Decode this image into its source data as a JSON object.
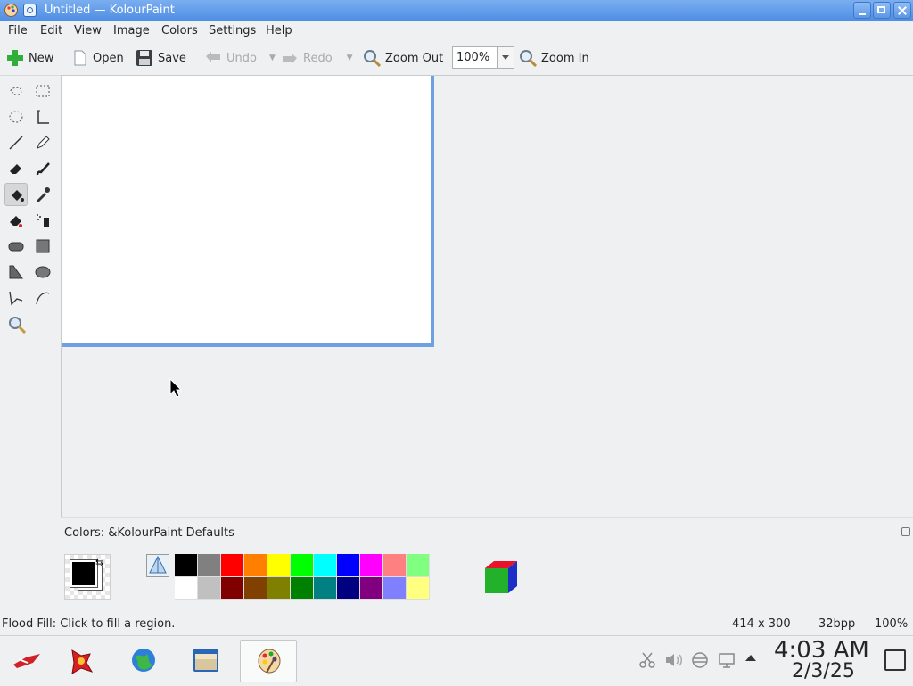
{
  "window": {
    "title": "Untitled — KolourPaint",
    "buttons": {
      "minimize": "minimize",
      "maximize": "maximize",
      "close": "close"
    }
  },
  "menubar": {
    "items": [
      "File",
      "Edit",
      "View",
      "Image",
      "Colors",
      "Settings",
      "Help"
    ]
  },
  "toolbar": {
    "new_label": "New",
    "open_label": "Open",
    "save_label": "Save",
    "undo_label": "Undo",
    "redo_label": "Redo",
    "zoom_out_label": "Zoom Out",
    "zoom_value": "100%",
    "zoom_in_label": "Zoom In"
  },
  "tools": [
    {
      "name": "free-form-selection",
      "icon": "lasso-icon"
    },
    {
      "name": "rectangular-selection",
      "icon": "rect-select-icon"
    },
    {
      "name": "elliptical-selection",
      "icon": "ellipse-select-icon"
    },
    {
      "name": "text",
      "icon": "text-icon"
    },
    {
      "name": "line",
      "icon": "line-icon"
    },
    {
      "name": "pen",
      "icon": "pen-icon"
    },
    {
      "name": "eraser",
      "icon": "eraser-icon"
    },
    {
      "name": "brush",
      "icon": "brush-icon"
    },
    {
      "name": "flood-fill",
      "icon": "flood-fill-icon",
      "active": true
    },
    {
      "name": "color-picker",
      "icon": "color-picker-icon"
    },
    {
      "name": "color-eraser",
      "icon": "color-eraser-icon"
    },
    {
      "name": "spraycan",
      "icon": "spraycan-icon"
    },
    {
      "name": "rounded-rectangle",
      "icon": "rounded-rect-icon"
    },
    {
      "name": "rectangle",
      "icon": "rectangle-icon"
    },
    {
      "name": "polygon",
      "icon": "polygon-icon"
    },
    {
      "name": "ellipse",
      "icon": "ellipse-icon"
    },
    {
      "name": "connected-lines",
      "icon": "polyline-icon"
    },
    {
      "name": "curve",
      "icon": "curve-icon"
    },
    {
      "name": "zoom",
      "icon": "magnifier-icon"
    }
  ],
  "colorpanel": {
    "label": "Colors: &KolourPaint Defaults",
    "foreground": "#000000",
    "background": "#ffffff",
    "palette_top": [
      "#000000",
      "#808080",
      "#ff0000",
      "#ff8000",
      "#ffff00",
      "#00ff00",
      "#00ffff",
      "#0000ff",
      "#ff00ff",
      "#ff8080",
      "#80ff80"
    ],
    "palette_bottom": [
      "#ffffff",
      "#c0c0c0",
      "#800000",
      "#804000",
      "#808000",
      "#008000",
      "#008080",
      "#000080",
      "#800080",
      "#8080ff",
      "#ffff80"
    ]
  },
  "status": {
    "message": "Flood Fill: Click to fill a region.",
    "dimensions": "414 x 300",
    "depth": "32bpp",
    "zoom": "100%"
  },
  "taskbar": {
    "apps": [
      "launcher",
      "app-2",
      "browser",
      "file-manager",
      "kolourpaint"
    ],
    "time": "4:03 AM",
    "date": "2/3/25"
  }
}
